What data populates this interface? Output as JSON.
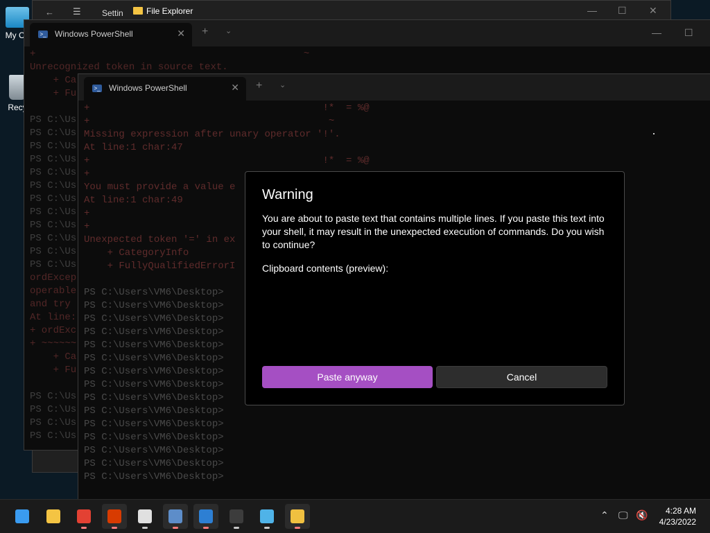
{
  "desktop": {
    "icons": [
      {
        "label": "My Co"
      },
      {
        "label": "Recy"
      }
    ]
  },
  "explorer": {
    "title": "File Explorer",
    "behind_label": "Settin",
    "controls": {
      "minimize": "—",
      "maximize": "☐",
      "close": "✕"
    }
  },
  "ps_back": {
    "tab_title": "Windows PowerShell",
    "lines": [
      {
        "t": "+                                              ~",
        "c": "err"
      },
      {
        "t": "Unrecognized token in source text.",
        "c": "err"
      },
      {
        "t": "    + Ca",
        "c": "err"
      },
      {
        "t": "    + Fu",
        "c": "err"
      },
      {
        "t": "",
        "c": ""
      },
      {
        "t": "PS C:\\Us",
        "c": "dim"
      },
      {
        "t": "PS C:\\Us",
        "c": "dim"
      },
      {
        "t": "PS C:\\Us",
        "c": "dim"
      },
      {
        "t": "PS C:\\Us",
        "c": "dim"
      },
      {
        "t": "PS C:\\Us",
        "c": "dim"
      },
      {
        "t": "PS C:\\Us",
        "c": "dim"
      },
      {
        "t": "PS C:\\Us",
        "c": "dim"
      },
      {
        "t": "PS C:\\Us",
        "c": "dim"
      },
      {
        "t": "PS C:\\Us",
        "c": "dim"
      },
      {
        "t": "PS C:\\Us",
        "c": "dim"
      },
      {
        "t": "PS C:\\Us",
        "c": "dim"
      },
      {
        "t": "PS C:\\Us",
        "c": "dim"
      },
      {
        "t": "ordExcep",
        "c": "err"
      },
      {
        "t": "operable",
        "c": "err"
      },
      {
        "t": "and try",
        "c": "err"
      },
      {
        "t": "At line:",
        "c": "err"
      },
      {
        "t": "+ ordExc",
        "c": "err"
      },
      {
        "t": "+ ~~~~~~",
        "c": "err"
      },
      {
        "t": "    + Ca",
        "c": "err"
      },
      {
        "t": "    + Fu",
        "c": "err"
      },
      {
        "t": "",
        "c": ""
      },
      {
        "t": "PS C:\\Us",
        "c": "dim"
      },
      {
        "t": "PS C:\\Us",
        "c": "dim"
      },
      {
        "t": "PS C:\\Us",
        "c": "dim"
      },
      {
        "t": "PS C:\\Us",
        "c": "dim"
      }
    ]
  },
  "ps_front": {
    "tab_title": "Windows PowerShell",
    "lines": [
      {
        "t": "+                                        !*  = %@",
        "c": "err"
      },
      {
        "t": "+                                         ~",
        "c": "err"
      },
      {
        "t": "Missing expression after unary operator '!'.",
        "c": "err"
      },
      {
        "t": "At line:1 char:47",
        "c": "err"
      },
      {
        "t": "+                                        !*  = %@",
        "c": "err"
      },
      {
        "t": "+",
        "c": "err"
      },
      {
        "t": "You must provide a value e",
        "c": "err"
      },
      {
        "t": "At line:1 char:49",
        "c": "err"
      },
      {
        "t": "+",
        "c": "err"
      },
      {
        "t": "+",
        "c": "err"
      },
      {
        "t": "Unexpected token '=' in ex",
        "c": "err"
      },
      {
        "t": "    + CategoryInfo",
        "c": "err"
      },
      {
        "t": "    + FullyQualifiedErrorI",
        "c": "err"
      },
      {
        "t": "",
        "c": ""
      },
      {
        "t": "PS C:\\Users\\VM6\\Desktop>",
        "c": "dim"
      },
      {
        "t": "PS C:\\Users\\VM6\\Desktop>",
        "c": "dim"
      },
      {
        "t": "PS C:\\Users\\VM6\\Desktop>",
        "c": "dim"
      },
      {
        "t": "PS C:\\Users\\VM6\\Desktop>",
        "c": "dim"
      },
      {
        "t": "PS C:\\Users\\VM6\\Desktop>",
        "c": "dim"
      },
      {
        "t": "PS C:\\Users\\VM6\\Desktop>",
        "c": "dim"
      },
      {
        "t": "PS C:\\Users\\VM6\\Desktop>",
        "c": "dim"
      },
      {
        "t": "PS C:\\Users\\VM6\\Desktop>",
        "c": "dim"
      },
      {
        "t": "PS C:\\Users\\VM6\\Desktop>",
        "c": "dim"
      },
      {
        "t": "PS C:\\Users\\VM6\\Desktop>",
        "c": "dim"
      },
      {
        "t": "PS C:\\Users\\VM6\\Desktop>",
        "c": "dim"
      },
      {
        "t": "PS C:\\Users\\VM6\\Desktop>",
        "c": "dim"
      },
      {
        "t": "PS C:\\Users\\VM6\\Desktop>",
        "c": "dim"
      },
      {
        "t": "PS C:\\Users\\VM6\\Desktop>",
        "c": "dim"
      },
      {
        "t": "PS C:\\Users\\VM6\\Desktop>",
        "c": "dim"
      }
    ]
  },
  "dialog": {
    "title": "Warning",
    "message": "You are about to paste text that contains multiple lines. If you paste this text into your shell, it may result in the unexpected execution of commands. Do you wish to continue?",
    "clipboard_label": "Clipboard contents (preview):",
    "paste_label": "Paste anyway",
    "cancel_label": "Cancel",
    "accent": "#a54fc3"
  },
  "taskbar": {
    "apps": [
      {
        "name": "start-icon",
        "color": "#3a9bf0",
        "running": false,
        "indicator": "none"
      },
      {
        "name": "file-explorer-icon",
        "color": "#f4c443",
        "running": false,
        "indicator": "none"
      },
      {
        "name": "chrome-icon",
        "color": "#e34133",
        "running": false,
        "indicator": "red"
      },
      {
        "name": "office-icon",
        "color": "#d83b01",
        "running": true,
        "indicator": "red"
      },
      {
        "name": "alarms-icon",
        "color": "#e0e0e0",
        "running": false,
        "indicator": "gray"
      },
      {
        "name": "settings-icon",
        "color": "#5d8dc9",
        "running": true,
        "indicator": "red"
      },
      {
        "name": "mail-icon",
        "color": "#2d7fd3",
        "running": true,
        "indicator": "red"
      },
      {
        "name": "terminal-icon",
        "color": "#3c3c3c",
        "running": false,
        "indicator": "gray"
      },
      {
        "name": "notepad-icon",
        "color": "#4fb3e8",
        "running": false,
        "indicator": "gray"
      },
      {
        "name": "folder-user-icon",
        "color": "#f0c040",
        "running": true,
        "indicator": "red"
      }
    ],
    "tray": {
      "chevron": "⌃",
      "network": "🖵",
      "volume": "🔇"
    },
    "time": "4:28 AM",
    "date": "4/23/2022"
  }
}
